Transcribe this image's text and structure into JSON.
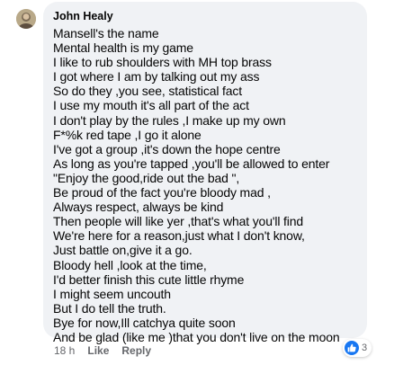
{
  "comment": {
    "author": "John Healy",
    "lines": [
      "Mansell's the name",
      "Mental health is my game",
      "I like to rub shoulders with MH top brass",
      "I got where I am by talking out my ass",
      "So do they ,you see, statistical fact",
      "I use my mouth it's all part of the act",
      "I don't play by the rules ,I make up my own",
      "F*%k red tape ,I go it alone",
      "I've got a group ,it's down the hope centre",
      "As long as you're tapped ,you'll be allowed to enter",
      "\"Enjoy the good,ride out the bad \",",
      "Be proud of the fact you're bloody mad ,",
      "Always respect, always be kind",
      "Then people will like yer ,that's what you'll find",
      "We're here for a reason,just what I don't know,",
      "Just battle on,give it a go.",
      "Bloody hell ,look at the time,",
      "I'd better finish this cute little rhyme",
      "I might seem uncouth",
      "But I do tell the truth.",
      "Bye for now,Ill catchya quite soon",
      "And be glad (like me )that you don't live on the moon"
    ]
  },
  "actions": {
    "timestamp": "18 h",
    "like_label": "Like",
    "reply_label": "Reply"
  },
  "reactions": {
    "icon": "thumbs-up-icon",
    "count": "3",
    "color": "#1877f2"
  }
}
